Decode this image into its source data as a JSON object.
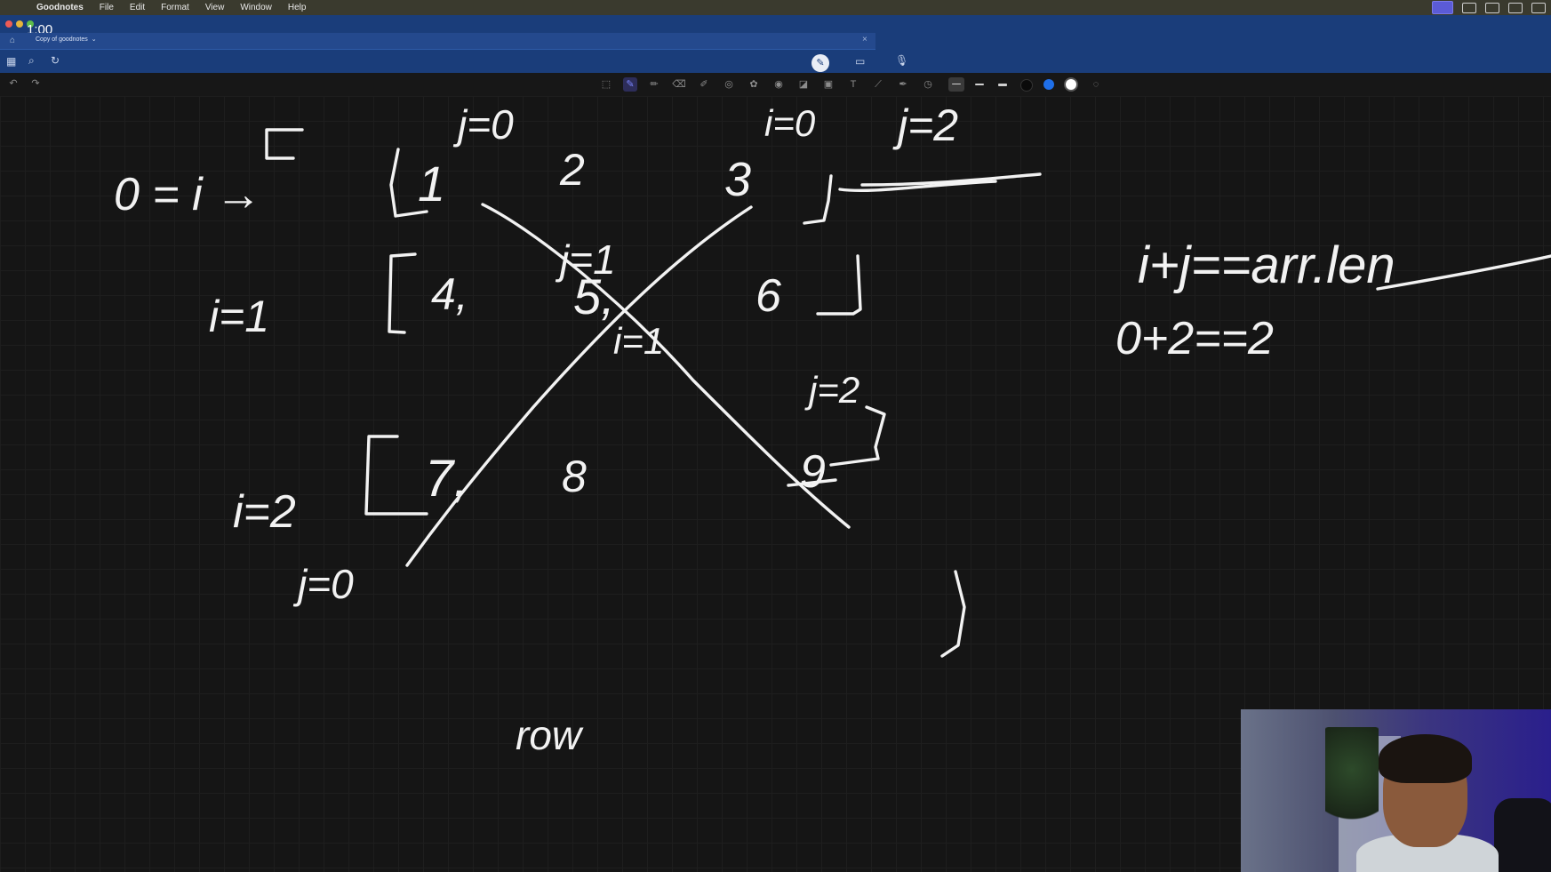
{
  "menubar": {
    "app_name": "Goodnotes",
    "items": [
      "File",
      "Edit",
      "Format",
      "View",
      "Window",
      "Help"
    ]
  },
  "header": {
    "timer": "1:00",
    "tab_title": "Copy of goodnotes",
    "tab_chevron": "⌄"
  },
  "toolbar": {
    "colors": [
      "#0a0a0a",
      "#1f6fe8",
      "#ffffff"
    ]
  },
  "canvas": {
    "notes": {
      "top_bracket": "[",
      "j0_top": "j=0",
      "zero_eq_i": "0 = i →",
      "one": "1",
      "two": "2",
      "three": "3",
      "i0_top_right": "i=0",
      "j2_top_right": "j=2",
      "j1_center": "j=1",
      "i1_left": "i=1",
      "four": "4,",
      "five": "5,",
      "six": "6",
      "i1_center": "i=1",
      "j2_right": "j=2",
      "i2_left": "i=2",
      "seven": "7,",
      "eight": "8",
      "nine": "9",
      "j0_bottom": "j=0",
      "closing_bracket": "]",
      "row": "row",
      "formula": "i+j==arr.len",
      "example": "0+2==2"
    }
  }
}
